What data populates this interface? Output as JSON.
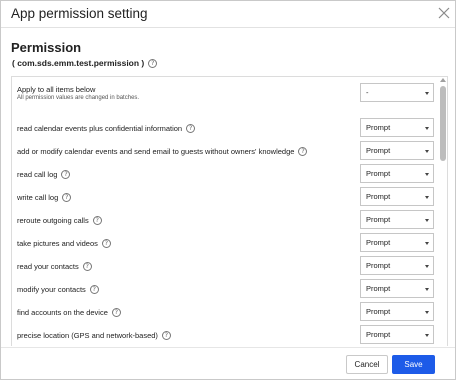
{
  "dialog": {
    "title": "App permission setting",
    "close_icon": "close-icon"
  },
  "permission": {
    "section_title": "Permission",
    "package": "( com.sds.emm.test.permission )",
    "help_icon": "help-icon"
  },
  "apply_all": {
    "label": "Apply to all items below",
    "sublabel": "All permission values are changed in batches.",
    "value": "-"
  },
  "permissions": [
    {
      "label": "read calendar events plus confidential information",
      "value": "Prompt"
    },
    {
      "label": "add or modify calendar events and send email to guests without owners' knowledge",
      "value": "Prompt"
    },
    {
      "label": "read call log",
      "value": "Prompt"
    },
    {
      "label": "write call log",
      "value": "Prompt"
    },
    {
      "label": "reroute outgoing calls",
      "value": "Prompt"
    },
    {
      "label": "take pictures and videos",
      "value": "Prompt"
    },
    {
      "label": "read your contacts",
      "value": "Prompt"
    },
    {
      "label": "modify your contacts",
      "value": "Prompt"
    },
    {
      "label": "find accounts on the device",
      "value": "Prompt"
    },
    {
      "label": "precise location (GPS and network-based)",
      "value": "Prompt"
    },
    {
      "label": "",
      "value": ""
    }
  ],
  "footer": {
    "cancel_label": "Cancel",
    "save_label": "Save"
  },
  "colors": {
    "primary": "#1d5be8",
    "border": "#c9c9c9"
  }
}
